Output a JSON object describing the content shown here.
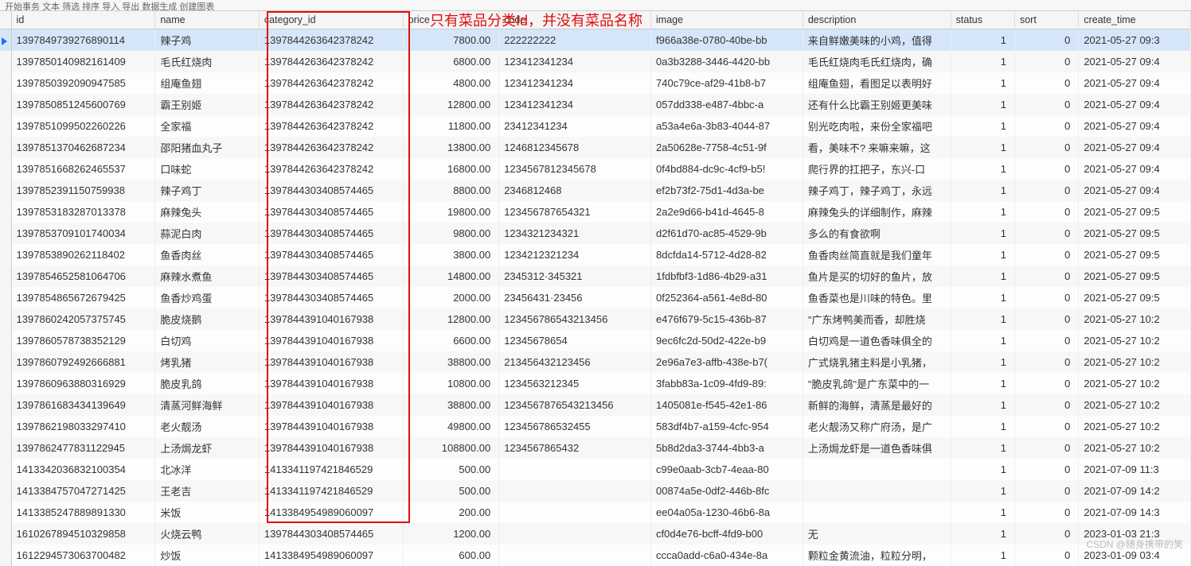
{
  "toolbar_hint": "开始事务  文本  筛选  排序  导入  导出  数据生成  创建图表",
  "annotation": "只有菜品分类Id，并没有菜品名称",
  "watermark": "CSDN @随身携带的笑",
  "columns": [
    "id",
    "name",
    "category_id",
    "price",
    "code",
    "image",
    "description",
    "status",
    "sort",
    "create_time"
  ],
  "rows": [
    {
      "id": "1397849739276890114",
      "name": "辣子鸡",
      "category_id": "1397844263642378242",
      "price": "7800.00",
      "code": "222222222",
      "image": "f966a38e-0780-40be-bb",
      "description": "来自鲜嫩美味的小鸡，值得",
      "status": "1",
      "sort": "0",
      "create_time": "2021-05-27 09:3"
    },
    {
      "id": "1397850140982161409",
      "name": "毛氏红烧肉",
      "category_id": "1397844263642378242",
      "price": "6800.00",
      "code": "123412341234",
      "image": "0a3b3288-3446-4420-bb",
      "description": "毛氏红烧肉毛氏红烧肉，确",
      "status": "1",
      "sort": "0",
      "create_time": "2021-05-27 09:4"
    },
    {
      "id": "1397850392090947585",
      "name": "组庵鱼翅",
      "category_id": "1397844263642378242",
      "price": "4800.00",
      "code": "123412341234",
      "image": "740c79ce-af29-41b8-b7",
      "description": "组庵鱼翅，看图足以表明好",
      "status": "1",
      "sort": "0",
      "create_time": "2021-05-27 09:4"
    },
    {
      "id": "1397850851245600769",
      "name": "霸王别姬",
      "category_id": "1397844263642378242",
      "price": "12800.00",
      "code": "123412341234",
      "image": "057dd338-e487-4bbc-a",
      "description": "还有什么比霸王别姬更美味",
      "status": "1",
      "sort": "0",
      "create_time": "2021-05-27 09:4"
    },
    {
      "id": "1397851099502260226",
      "name": "全家福",
      "category_id": "1397844263642378242",
      "price": "11800.00",
      "code": "23412341234",
      "image": "a53a4e6a-3b83-4044-87",
      "description": "别光吃肉啦，来份全家福吧",
      "status": "1",
      "sort": "0",
      "create_time": "2021-05-27 09:4"
    },
    {
      "id": "1397851370462687234",
      "name": "邵阳猪血丸子",
      "category_id": "1397844263642378242",
      "price": "13800.00",
      "code": "1246812345678",
      "image": "2a50628e-7758-4c51-9f",
      "description": "看，美味不? 来嘛来嘛，这",
      "status": "1",
      "sort": "0",
      "create_time": "2021-05-27 09:4"
    },
    {
      "id": "1397851668262465537",
      "name": "口味蛇",
      "category_id": "1397844263642378242",
      "price": "16800.00",
      "code": "1234567812345678",
      "image": "0f4bd884-dc9c-4cf9-b5!",
      "description": "爬行界的扛把子，东兴-口",
      "status": "1",
      "sort": "0",
      "create_time": "2021-05-27 09:4"
    },
    {
      "id": "1397852391150759938",
      "name": "辣子鸡丁",
      "category_id": "1397844303408574465",
      "price": "8800.00",
      "code": "2346812468",
      "image": "ef2b73f2-75d1-4d3a-be",
      "description": "辣子鸡丁，辣子鸡丁，永远",
      "status": "1",
      "sort": "0",
      "create_time": "2021-05-27 09:4"
    },
    {
      "id": "1397853183287013378",
      "name": "麻辣兔头",
      "category_id": "1397844303408574465",
      "price": "19800.00",
      "code": "123456787654321",
      "image": "2a2e9d66-b41d-4645-8",
      "description": "麻辣兔头的详细制作，麻辣",
      "status": "1",
      "sort": "0",
      "create_time": "2021-05-27 09:5"
    },
    {
      "id": "1397853709101740034",
      "name": "蒜泥白肉",
      "category_id": "1397844303408574465",
      "price": "9800.00",
      "code": "1234321234321",
      "image": "d2f61d70-ac85-4529-9b",
      "description": "多么的有食欲啊",
      "status": "1",
      "sort": "0",
      "create_time": "2021-05-27 09:5"
    },
    {
      "id": "1397853890262118402",
      "name": "鱼香肉丝",
      "category_id": "1397844303408574465",
      "price": "3800.00",
      "code": "1234212321234",
      "image": "8dcfda14-5712-4d28-82",
      "description": "鱼香肉丝简直就是我们童年",
      "status": "1",
      "sort": "0",
      "create_time": "2021-05-27 09:5"
    },
    {
      "id": "1397854652581064706",
      "name": "麻辣水煮鱼",
      "category_id": "1397844303408574465",
      "price": "14800.00",
      "code": "2345312·345321",
      "image": "1fdbfbf3-1d86-4b29-a31",
      "description": "鱼片是买的切好的鱼片，放",
      "status": "1",
      "sort": "0",
      "create_time": "2021-05-27 09:5"
    },
    {
      "id": "1397854865672679425",
      "name": "鱼香炒鸡蛋",
      "category_id": "1397844303408574465",
      "price": "2000.00",
      "code": "23456431·23456",
      "image": "0f252364-a561-4e8d-80",
      "description": "鱼香菜也是川味的特色。里",
      "status": "1",
      "sort": "0",
      "create_time": "2021-05-27 09:5"
    },
    {
      "id": "1397860242057375745",
      "name": "脆皮烧鹅",
      "category_id": "1397844391040167938",
      "price": "12800.00",
      "code": "123456786543213456",
      "image": "e476f679-5c15-436b-87",
      "description": "\"广东烤鸭美而香，却胜烧",
      "status": "1",
      "sort": "0",
      "create_time": "2021-05-27 10:2"
    },
    {
      "id": "1397860578738352129",
      "name": "白切鸡",
      "category_id": "1397844391040167938",
      "price": "6600.00",
      "code": "12345678654",
      "image": "9ec6fc2d-50d2-422e-b9",
      "description": "白切鸡是一道色香味俱全的",
      "status": "1",
      "sort": "0",
      "create_time": "2021-05-27 10:2"
    },
    {
      "id": "1397860792492666881",
      "name": "烤乳猪",
      "category_id": "1397844391040167938",
      "price": "38800.00",
      "code": "213456432123456",
      "image": "2e96a7e3-affb-438e-b7(",
      "description": "广式烧乳猪主料是小乳猪，",
      "status": "1",
      "sort": "0",
      "create_time": "2021-05-27 10:2"
    },
    {
      "id": "1397860963880316929",
      "name": "脆皮乳鸽",
      "category_id": "1397844391040167938",
      "price": "10800.00",
      "code": "1234563212345",
      "image": "3fabb83a-1c09-4fd9-89:",
      "description": "\"脆皮乳鸽\"是广东菜中的一",
      "status": "1",
      "sort": "0",
      "create_time": "2021-05-27 10:2"
    },
    {
      "id": "1397861683434139649",
      "name": "清蒸河鲜海鲜",
      "category_id": "1397844391040167938",
      "price": "38800.00",
      "code": "1234567876543213456",
      "image": "1405081e-f545-42e1-86",
      "description": "新鲜的海鲜，清蒸是最好的",
      "status": "1",
      "sort": "0",
      "create_time": "2021-05-27 10:2"
    },
    {
      "id": "1397862198033297410",
      "name": "老火靓汤",
      "category_id": "1397844391040167938",
      "price": "49800.00",
      "code": "123456786532455",
      "image": "583df4b7-a159-4cfc-954",
      "description": "老火靓汤又称广府汤，是广",
      "status": "1",
      "sort": "0",
      "create_time": "2021-05-27 10:2"
    },
    {
      "id": "1397862477831122945",
      "name": "上汤焗龙虾",
      "category_id": "1397844391040167938",
      "price": "108800.00",
      "code": "1234567865432",
      "image": "5b8d2da3-3744-4bb3-a",
      "description": "上汤焗龙虾是一道色香味俱",
      "status": "1",
      "sort": "0",
      "create_time": "2021-05-27 10:2"
    },
    {
      "id": "1413342036832100354",
      "name": "北冰洋",
      "category_id": "1413341197421846529",
      "price": "500.00",
      "code": "",
      "image": "c99e0aab-3cb7-4eaa-80",
      "description": "",
      "status": "1",
      "sort": "0",
      "create_time": "2021-07-09 11:3"
    },
    {
      "id": "1413384757047271425",
      "name": "王老吉",
      "category_id": "1413341197421846529",
      "price": "500.00",
      "code": "",
      "image": "00874a5e-0df2-446b-8fc",
      "description": "",
      "status": "1",
      "sort": "0",
      "create_time": "2021-07-09 14:2"
    },
    {
      "id": "1413385247889891330",
      "name": "米饭",
      "category_id": "1413384954989060097",
      "price": "200.00",
      "code": "",
      "image": "ee04a05a-1230-46b6-8a",
      "description": "",
      "status": "1",
      "sort": "0",
      "create_time": "2021-07-09 14:3"
    },
    {
      "id": "1610267894510329858",
      "name": "火烧云鸭",
      "category_id": "1397844303408574465",
      "price": "1200.00",
      "code": "",
      "image": "cf0d4e76-bcff-4fd9-b00",
      "description": "无",
      "status": "1",
      "sort": "0",
      "create_time": "2023-01-03 21:3"
    },
    {
      "id": "1612294573063700482",
      "name": "炒饭",
      "category_id": "1413384954989060097",
      "price": "600.00",
      "code": "",
      "image": "ccca0add-c6a0-434e-8a",
      "description": "颗粒金黄流油，粒粒分明，",
      "status": "1",
      "sort": "0",
      "create_time": "2023-01-09 03:4"
    }
  ]
}
